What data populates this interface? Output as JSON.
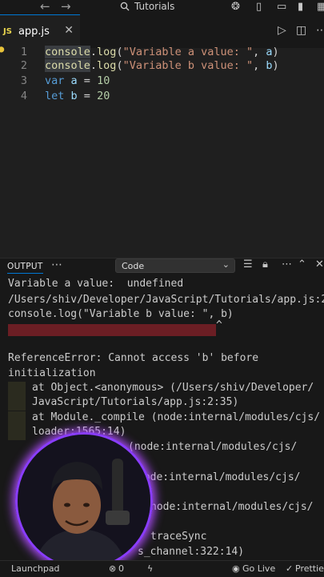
{
  "titlebar": {
    "back_icon": "arrow-left",
    "forward_icon": "arrow-right",
    "search_text": "Tutorials",
    "search_icon": "magnifier"
  },
  "tabs": [
    {
      "icon": "JS",
      "label": "app.js",
      "active": true
    }
  ],
  "editor": {
    "lines": [
      {
        "number": "1",
        "text": "console.log(\"Variable a value: \", a)"
      },
      {
        "number": "2",
        "text": "console.log(\"Variable b value: \", b)"
      },
      {
        "number": "3",
        "text": "var a = 10"
      },
      {
        "number": "4",
        "text": "let b = 20"
      }
    ]
  },
  "panel": {
    "title": "OUTPUT",
    "channel": "Code",
    "lines": [
      "Variable a value:  undefined",
      "/Users/shiv/Developer/JavaScript/Tutorials/app.js:2",
      "console.log(\"Variable b value: \", b)",
      "ReferenceError: Cannot access 'b' before",
      "initialization",
      "at Object.<anonymous> (/Users/shiv/Developer/",
      "JavaScript/Tutorials/app.js:2:35)",
      "at Module._compile (node:internal/modules/cjs/",
      "loader:1565:14)",
      "(node:internal/modules/cjs/",
      "node:internal/modules/cjs/",
      "node:internal/modules/cjs/",
      "traceSync",
      "s_channel:322:14)"
    ],
    "caret": "^"
  },
  "statusbar": {
    "left_label": "Launchpad",
    "errors": "0",
    "golive": "Go Live",
    "prettier": "Prettier"
  },
  "colors": {
    "accent": "#0078d4",
    "error_highlight": "#6b1e24",
    "webcam_ring": "#8a3dff"
  }
}
